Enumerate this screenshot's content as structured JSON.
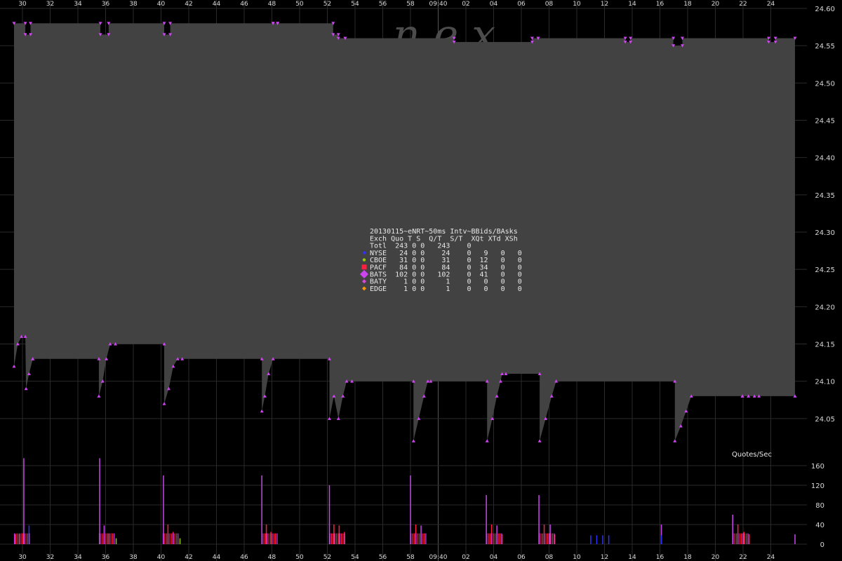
{
  "chart_data": {
    "type": "area",
    "watermark": "n e x",
    "colors": {
      "background": "#000000",
      "area_fill": "#424242",
      "grid": "#2a2a2a",
      "bid": "#cc44ee",
      "ask": "#cc44ee",
      "NYSE": "#3030ff",
      "CBOE": "#99cc00",
      "PACF": "#ff2040",
      "BATS": "#cc44ee",
      "BATY": "#dd44dd",
      "EDGE": "#ff9900"
    },
    "price_axis": {
      "ticks": [
        "24.60",
        "24.55",
        "24.50",
        "24.45",
        "24.40",
        "24.35",
        "24.30",
        "24.25",
        "24.20",
        "24.15",
        "24.10",
        "24.05"
      ],
      "ylim": [
        24.0,
        24.6
      ]
    },
    "time_axis": {
      "tick_labels": [
        "30",
        "32",
        "34",
        "36",
        "38",
        "40",
        "42",
        "44",
        "46",
        "48",
        "50",
        "52",
        "54",
        "56",
        "58",
        "09:40",
        "02",
        "04",
        "06",
        "08",
        "10",
        "12",
        "14",
        "16",
        "18",
        "20",
        "22",
        "24"
      ],
      "range_seconds": [
        0,
        104
      ],
      "highlight_label": "09:40"
    },
    "legend": {
      "title": "20130115~eNRT~50ms Intv~BBids/BAsks",
      "header": "Exch Quo T S  Q/T  S/T  XQt XTd XSh",
      "rows": [
        {
          "text": "Totl  243 0 0   243    0",
          "marker": "none"
        },
        {
          "text": "NYSE   24 0 0    24    0   9   0   0",
          "marker": "NYSE"
        },
        {
          "text": "CBOE   31 0 0    31    0  12   0   0",
          "marker": "CBOE"
        },
        {
          "text": "PACF   84 0 0    84    0  34   0   0",
          "marker": "PACF"
        },
        {
          "text": "BATS  102 0 0   102    0  41   0   0",
          "marker": "BATS"
        },
        {
          "text": "BATY    1 0 0     1    0   0   0   0",
          "marker": "BATY"
        },
        {
          "text": "EDGE    1 0 0     1    0   0   0   0",
          "marker": "EDGE"
        }
      ]
    },
    "series": [
      {
        "name": "Ask",
        "x": [
          0,
          1.5,
          1.5,
          2.2,
          2.2,
          11.5,
          11.5,
          12.6,
          12.6,
          20,
          20,
          20.8,
          20.8,
          34.5,
          34.5,
          35.1,
          35.1,
          42.5,
          42.5,
          43.2,
          43.2,
          44.1,
          44.1,
          58.6,
          58.6,
          69,
          69,
          69.8,
          69.8,
          81.4,
          81.4,
          82.1,
          82.1,
          87.8,
          87.8,
          89,
          89,
          100.5,
          100.5,
          101.4,
          101.4,
          104
        ],
        "y": [
          24.58,
          24.58,
          24.565,
          24.565,
          24.58,
          24.58,
          24.565,
          24.565,
          24.58,
          24.58,
          24.565,
          24.565,
          24.58,
          24.58,
          24.58,
          24.58,
          24.58,
          24.58,
          24.565,
          24.565,
          24.56,
          24.56,
          24.56,
          24.56,
          24.555,
          24.555,
          24.56,
          24.56,
          24.56,
          24.56,
          24.555,
          24.555,
          24.56,
          24.56,
          24.55,
          24.55,
          24.56,
          24.56,
          24.555,
          24.555,
          24.56,
          24.56
        ]
      },
      {
        "name": "Bid",
        "x": [
          0,
          0.5,
          1.0,
          1.5,
          1.6,
          2.0,
          2.5,
          2.5,
          11.3,
          11.3,
          11.8,
          12.3,
          12.8,
          13.5,
          20.0,
          20.0,
          20.6,
          21.2,
          21.8,
          22.4,
          33.0,
          33.0,
          33.4,
          33.9,
          34.5,
          42.0,
          42.0,
          42.6,
          43.2,
          43.8,
          44.3,
          45.0,
          53.2,
          53.2,
          53.9,
          54.6,
          55.1,
          55.5,
          63.0,
          63.0,
          63.7,
          64.3,
          64.8,
          65.0,
          65.5,
          70.0,
          70.0,
          70.8,
          71.6,
          72.2,
          88.0,
          88.0,
          88.8,
          89.5,
          90.2,
          97.0,
          97.0,
          97.8,
          98.6,
          99.2,
          104.0
        ],
        "y": [
          24.12,
          24.15,
          24.16,
          24.16,
          24.09,
          24.11,
          24.13,
          24.13,
          24.13,
          24.08,
          24.1,
          24.13,
          24.15,
          24.15,
          24.15,
          24.07,
          24.09,
          24.12,
          24.13,
          24.13,
          24.13,
          24.06,
          24.08,
          24.11,
          24.13,
          24.13,
          24.05,
          24.08,
          24.05,
          24.08,
          24.1,
          24.1,
          24.1,
          24.02,
          24.05,
          24.08,
          24.1,
          24.1,
          24.1,
          24.02,
          24.05,
          24.08,
          24.1,
          24.11,
          24.11,
          24.11,
          24.02,
          24.05,
          24.08,
          24.1,
          24.1,
          24.02,
          24.04,
          24.06,
          24.08,
          24.08,
          24.08,
          24.08,
          24.08,
          24.08,
          24.08
        ]
      }
    ],
    "quotes_per_sec": {
      "label": "Quotes/Sec",
      "ticks": [
        "160",
        "120",
        "80",
        "40",
        "0"
      ],
      "ylim": [
        0,
        180
      ],
      "bars": [
        {
          "t": 1.3,
          "v": 175,
          "color": "BATS"
        },
        {
          "t": 2.0,
          "v": 38,
          "color": "NYSE"
        },
        {
          "t": 0.2,
          "v": 20,
          "color": "PACF"
        },
        {
          "t": 0.7,
          "v": 20,
          "color": "PACF"
        },
        {
          "t": 11.4,
          "v": 175,
          "color": "BATS"
        },
        {
          "t": 12.0,
          "v": 38,
          "color": "BATS"
        },
        {
          "t": 12.5,
          "v": 22,
          "color": "PACF"
        },
        {
          "t": 13.6,
          "v": 12,
          "color": "CBOE"
        },
        {
          "t": 19.9,
          "v": 140,
          "color": "BATS"
        },
        {
          "t": 20.5,
          "v": 40,
          "color": "PACF"
        },
        {
          "t": 21.2,
          "v": 25,
          "color": "PACF"
        },
        {
          "t": 22.1,
          "v": 12,
          "color": "CBOE"
        },
        {
          "t": 33.0,
          "v": 140,
          "color": "BATS"
        },
        {
          "t": 33.6,
          "v": 40,
          "color": "PACF"
        },
        {
          "t": 34.2,
          "v": 25,
          "color": "PACF"
        },
        {
          "t": 34.8,
          "v": 20,
          "color": "PACF"
        },
        {
          "t": 42.0,
          "v": 120,
          "color": "BATS"
        },
        {
          "t": 42.6,
          "v": 40,
          "color": "PACF"
        },
        {
          "t": 43.3,
          "v": 38,
          "color": "PACF"
        },
        {
          "t": 44.0,
          "v": 25,
          "color": "PACF"
        },
        {
          "t": 52.8,
          "v": 140,
          "color": "BATS"
        },
        {
          "t": 53.5,
          "v": 40,
          "color": "PACF"
        },
        {
          "t": 54.2,
          "v": 38,
          "color": "BATS"
        },
        {
          "t": 62.9,
          "v": 100,
          "color": "BATS"
        },
        {
          "t": 63.6,
          "v": 40,
          "color": "PACF"
        },
        {
          "t": 64.3,
          "v": 38,
          "color": "BATS"
        },
        {
          "t": 65.0,
          "v": 20,
          "color": "PACF"
        },
        {
          "t": 69.9,
          "v": 100,
          "color": "BATS"
        },
        {
          "t": 70.6,
          "v": 40,
          "color": "PACF"
        },
        {
          "t": 71.4,
          "v": 40,
          "color": "BATS"
        },
        {
          "t": 72.0,
          "v": 20,
          "color": "PACF"
        },
        {
          "t": 76.8,
          "v": 18,
          "color": "NYSE"
        },
        {
          "t": 77.6,
          "v": 18,
          "color": "NYSE"
        },
        {
          "t": 78.4,
          "v": 18,
          "color": "NYSE"
        },
        {
          "t": 79.2,
          "v": 18,
          "color": "NYSE"
        },
        {
          "t": 86.2,
          "v": 40,
          "color": "BATS"
        },
        {
          "t": 86.2,
          "v": 18,
          "color": "NYSE"
        },
        {
          "t": 95.7,
          "v": 60,
          "color": "BATS"
        },
        {
          "t": 96.4,
          "v": 40,
          "color": "PACF"
        },
        {
          "t": 97.2,
          "v": 25,
          "color": "PACF"
        },
        {
          "t": 97.9,
          "v": 20,
          "color": "PACF"
        },
        {
          "t": 104.0,
          "v": 20,
          "color": "BATS"
        }
      ]
    }
  }
}
